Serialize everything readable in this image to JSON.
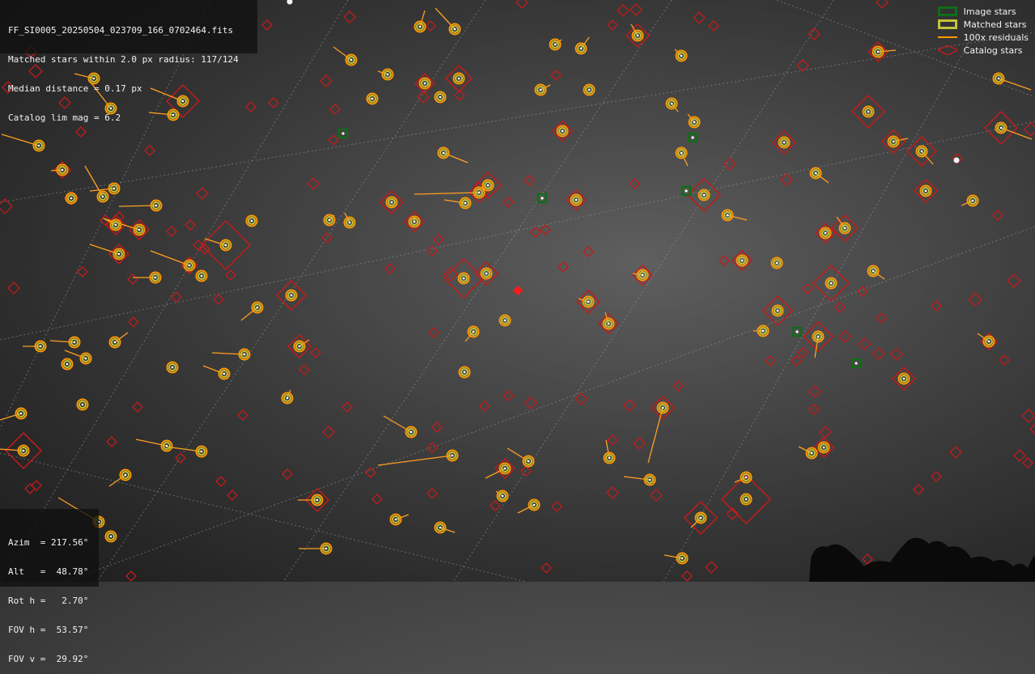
{
  "info": {
    "filename": "FF_SI0005_20250504_023709_166_0702464.fits",
    "matched_line": "Matched stars within 2.0 px radius: 117/124",
    "median_line": "Median distance = 0.17 px",
    "limmag_line": "Catalog lim mag = 6.2"
  },
  "pointing": {
    "azim": "Azim  = 217.56°",
    "alt": "Alt   =  48.78°",
    "rot": "Rot h =   2.70°",
    "fov_h": "FOV h =  53.57°",
    "fov_v": "FOV v =  29.92°"
  },
  "legend": {
    "image_stars": "Image stars",
    "matched_stars": "Matched stars",
    "residuals": "100x residuals",
    "catalog_stars": "Catalog stars"
  },
  "colors": {
    "image_star": "#0f6d16",
    "matched_outer": "#ff9a00",
    "matched_inner": "#c3c33a",
    "residual": "#ffa020",
    "catalog": "#c41a1a",
    "center_marker": "#ff1a1a",
    "grid": "#9a9a9a"
  }
}
